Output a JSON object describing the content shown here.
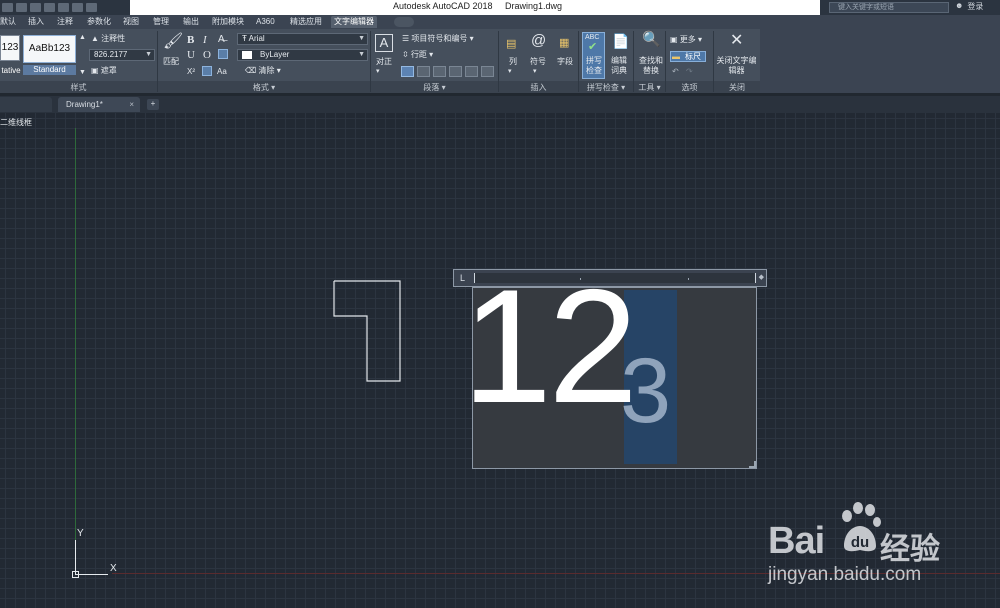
{
  "window": {
    "title": "Autodesk AutoCAD 2018",
    "filename": "Drawing1.dwg",
    "search_placeholder": "键入关键字或短语",
    "login": "登录"
  },
  "menu": {
    "tabs": [
      "默认",
      "插入",
      "注释",
      "参数化",
      "视图",
      "管理",
      "输出",
      "附加模块",
      "A360",
      "精选应用",
      "文字编辑器"
    ],
    "active": "文字编辑器"
  },
  "ribbon": {
    "style": {
      "preview_left": "123",
      "preview_left_caption": "tative",
      "preview_main": "AaBb123",
      "preview_main_caption": "Standard",
      "annotative": "注释性",
      "height_value": "826.2177",
      "mask": "遮罩",
      "panel_label": "样式"
    },
    "format": {
      "match": "匹配",
      "bold": "B",
      "italic": "I",
      "strike": "A̶",
      "underline": "U",
      "overline": "O",
      "font": "Arial",
      "color": "ByLayer",
      "superscript": "X²",
      "subscript": "X",
      "case": "Aa",
      "clear": "清除",
      "panel_label": "格式"
    },
    "paragraph": {
      "justify": "对正",
      "bullets": "项目符号和编号",
      "line_spacing": "行距",
      "panel_label": "段落"
    },
    "insert": {
      "columns": "列",
      "symbol": "符号",
      "field": "字段",
      "panel_label": "插入"
    },
    "spell": {
      "abc": "ABC",
      "check": "拼写检查",
      "edit_dict": "编辑词典",
      "panel_label": "拼写检查"
    },
    "tools": {
      "find_replace": "查找和替换",
      "panel_label": "工具"
    },
    "options": {
      "more": "更多",
      "ruler": "标尺",
      "panel_label": "选项"
    },
    "close": {
      "label": "关闭文字编辑器",
      "panel_label": "关闭"
    }
  },
  "file_tabs": {
    "doc": "Drawing1*",
    "close": "×",
    "add": "+"
  },
  "viewport": {
    "label": "二维线框",
    "ucs_x": "X",
    "ucs_y": "Y"
  },
  "mtext": {
    "normal_text": "12",
    "selected_text": "3"
  },
  "watermark": {
    "brand": "Bai",
    "brand_cn": "经验",
    "url": "jingyan.baidu.com"
  }
}
